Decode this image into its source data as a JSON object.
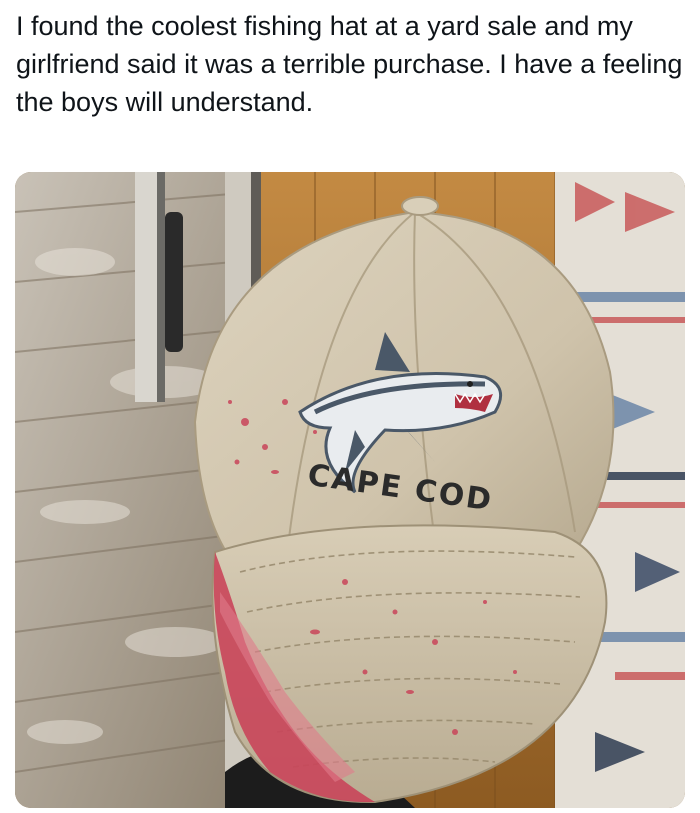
{
  "post": {
    "caption": "I found the coolest fishing hat at a yard sale and my girlfriend said it was a terrible purchase. I have a feeling the boys will understand."
  },
  "photo": {
    "cap_embroidery_text": "CAPE COD",
    "colors": {
      "cap_khaki": "#cfc3ab",
      "blood_red": "#c9455a",
      "deck_wood": "#a99b8a",
      "floor_wood": "#b47a34",
      "rug_blue": "#6c86a8",
      "shark_gray": "#4a5868"
    }
  }
}
